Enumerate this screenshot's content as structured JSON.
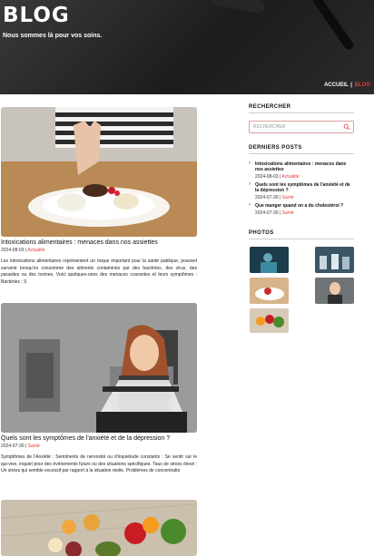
{
  "header": {
    "title": "BLOG",
    "tagline": "Nous sommes là pour vos soins.",
    "nav": {
      "home": "ACCUEIL",
      "separator": "|",
      "blog": "BLOG"
    }
  },
  "posts": [
    {
      "title": "Intoxications alimentaires : menaces dans nos assiettes",
      "date": "2024-08-03",
      "separator": "|",
      "category": "Actualité",
      "excerpt": "Les intoxications alimentaires représentent un risque important pour la santé publique, pouvant survenir lorsqu'on consomme des aliments contaminés par des bactéries, des virus, des parasites ou des toxines. Voici quelques-unes des menaces courantes et leurs symptômes : Bactéries : S"
    },
    {
      "title": "Quels sont les symptômes de l'anxiété et de la dépression ?",
      "date": "2024-07-30",
      "separator": "|",
      "category": "Santé",
      "excerpt": "Symptômes de l'Anxiété : Sentiments de nervosité ou d'inquiétude constants : Se sentir sur le qui-vive, inquiet pour des événements futurs ou des situations spécifiques. Taux de stress élevé : Un stress qui semble excessif par rapport à la situation réelle. Problèmes de concentratio"
    }
  ],
  "sidebar": {
    "search": {
      "heading": "RECHERCHER",
      "placeholder": "RECHERCHER"
    },
    "recent": {
      "heading": "DERNIERS POSTS",
      "items": [
        {
          "title": "Intoxications alimentaires : menaces dans nos assiettes",
          "date": "2024-08-03",
          "separator": "|",
          "category": "Actualité"
        },
        {
          "title": "Quels sont les symptômes de l'anxiété et de la dépression ?",
          "date": "2024-07-30",
          "separator": "|",
          "category": "Santé"
        },
        {
          "title": "Que manger quand on a du cholestérol ?",
          "date": "2024-07-30",
          "separator": "|",
          "category": "Santé"
        }
      ]
    },
    "photos": {
      "heading": "PHOTOS"
    }
  },
  "colors": {
    "accent": "#e53935",
    "hero_bg": "#242424"
  }
}
